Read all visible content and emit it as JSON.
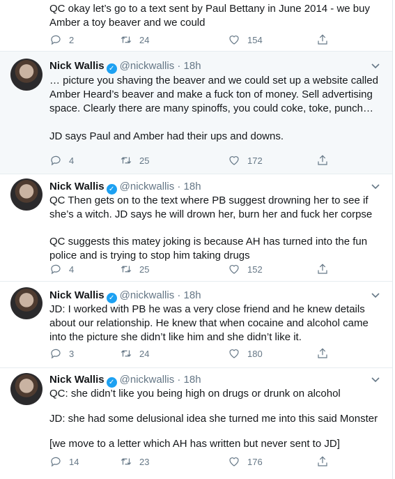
{
  "tweets": [
    {
      "body": [
        "QC okay let’s go to a text sent by Paul Bettany in June 2014 - we buy Amber a toy beaver and we could"
      ],
      "replies": "2",
      "retweets": "24",
      "likes": "154"
    },
    {
      "name": "Nick Wallis",
      "handle": "@nickwallis · 18h",
      "body": [
        "… picture you shaving the beaver and we could set up a website called Amber Heard’s beaver and make a fuck ton of money. Sell advertising space. Clearly there are many spinoffs, you could coke, toke, punch…",
        "JD says Paul and Amber had their ups and downs."
      ],
      "replies": "4",
      "retweets": "25",
      "likes": "172"
    },
    {
      "name": "Nick Wallis",
      "handle": "@nickwallis · 18h",
      "body": [
        "QC Then gets on to the text where PB suggest drowning her to see if she’s a witch. JD says he will drown her, burn her and fuck her corpse",
        "QC suggests this matey joking is because AH has turned into the fun police and is trying to stop him taking drugs"
      ],
      "replies": "4",
      "retweets": "25",
      "likes": "152"
    },
    {
      "name": "Nick Wallis",
      "handle": "@nickwallis · 18h",
      "body": [
        "JD: I worked with PB he was a very close friend and he knew details about our relationship. He knew that when cocaine and alcohol came into the picture she didn’t like him and she didn’t like it."
      ],
      "replies": "3",
      "retweets": "24",
      "likes": "180"
    },
    {
      "name": "Nick Wallis",
      "handle": "@nickwallis · 18h",
      "body": [
        "QC: she didn’t like you being high on drugs or drunk on alcohol",
        "JD: she had some delusional idea she turned me into this said Monster",
        "[we move to a letter which AH has written but never sent to JD]"
      ],
      "replies": "14",
      "retweets": "23",
      "likes": "176"
    }
  ],
  "icons": {
    "verified": "verified-badge-icon",
    "reply": "reply-icon",
    "retweet": "retweet-icon",
    "like": "heart-icon",
    "share": "share-icon",
    "caret": "chevron-down-icon"
  },
  "colors": {
    "accent": "#1da1f2",
    "muted": "#657786",
    "highlight_bg": "#f5f8fa"
  }
}
